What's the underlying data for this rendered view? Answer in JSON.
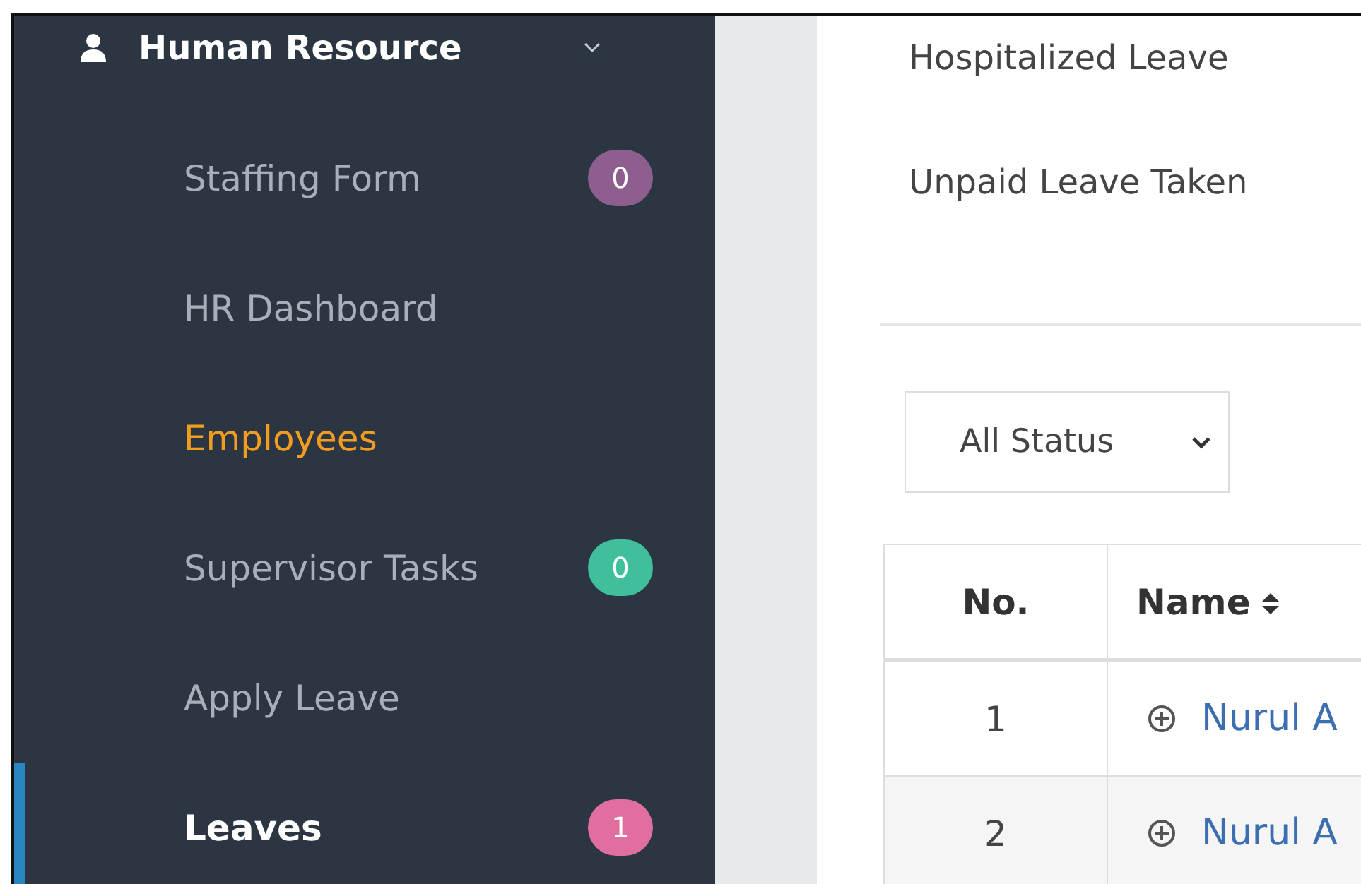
{
  "sidebar": {
    "section": {
      "label": "Human Resource",
      "expanded": true
    },
    "items": [
      {
        "label": "Staffing Form",
        "selected": false,
        "highlighted": false,
        "badge": {
          "text": "0",
          "color": "#8e5e8e"
        }
      },
      {
        "label": "HR Dashboard",
        "selected": false,
        "highlighted": false
      },
      {
        "label": "Employees",
        "selected": false,
        "highlighted": true
      },
      {
        "label": "Supervisor Tasks",
        "selected": false,
        "highlighted": false,
        "badge": {
          "text": "0",
          "color": "#3fbf9b"
        }
      },
      {
        "label": "Apply Leave",
        "selected": false,
        "highlighted": false
      },
      {
        "label": "Leaves",
        "selected": true,
        "highlighted": false,
        "badge": {
          "text": "1",
          "color": "#e06fa0"
        }
      }
    ]
  },
  "summary": [
    "Hospitalized Leave",
    "Unpaid Leave Taken"
  ],
  "filter": {
    "value": "All Status"
  },
  "table": {
    "columns": [
      "No.",
      "Name"
    ],
    "rows": [
      {
        "no": "1",
        "name": "Nurul A"
      },
      {
        "no": "2",
        "name": "Nurul A"
      }
    ]
  }
}
